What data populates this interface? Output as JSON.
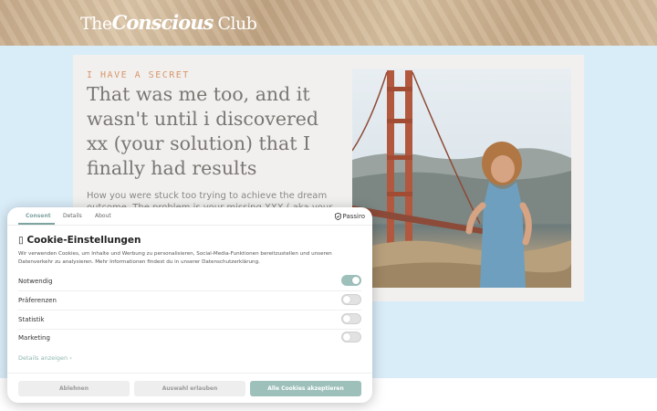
{
  "header": {
    "logo": {
      "part1": "The",
      "part2": "Conscious",
      "part3": "Club"
    }
  },
  "hero": {
    "eyebrow": "I HAVE A SECRET",
    "headline": "That was me too, and it wasn't until i discovered xx (your solution) that I finally had results",
    "body": "How you were stuck too trying to achieve the dream outcome. The problem is your missing XXX ( aka your"
  },
  "cookie": {
    "tabs": [
      "Consent",
      "Details",
      "About"
    ],
    "brand": "Passiro",
    "title": "Cookie-Einstellungen",
    "description": "Wir verwenden Cookies, um Inhalte und Werbung zu personalisieren, Social-Media-Funktionen bereitzustellen und unseren Datenverkehr zu analysieren. Mehr Informationen findest du in unserer Datenschutzerklärung.",
    "categories": [
      {
        "label": "Notwendig",
        "enabled": true
      },
      {
        "label": "Präferenzen",
        "enabled": false
      },
      {
        "label": "Statistik",
        "enabled": false
      },
      {
        "label": "Marketing",
        "enabled": false
      }
    ],
    "details_link": "Details anzeigen ›",
    "buttons": {
      "reject": "Ablehnen",
      "selection": "Auswahl erlauben",
      "accept_all": "Alle Cookies akzeptieren"
    },
    "accent_color": "#9ec0bb"
  }
}
